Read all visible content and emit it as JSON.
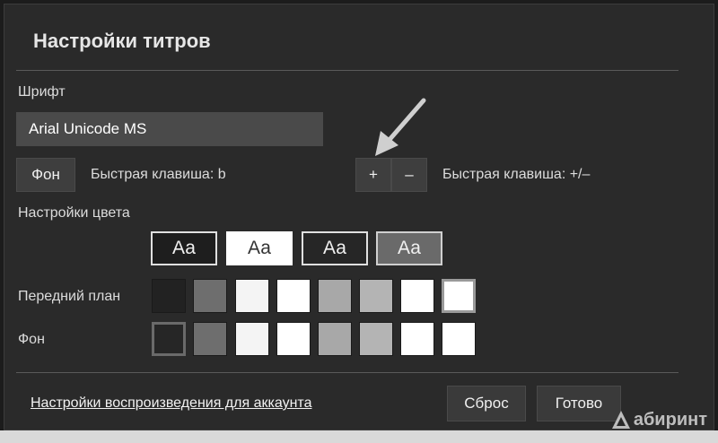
{
  "dialog": {
    "title": "Настройки титров",
    "font_section_label": "Шрифт",
    "font_value": "Arial Unicode MS",
    "background_button": "Фон",
    "background_hotkey": "Быстрая клавиша: b",
    "size_plus": "+",
    "size_minus": "–",
    "size_hotkey": "Быстрая клавиша: +/–",
    "color_section_label": "Настройки цвета",
    "previews": [
      {
        "text": "Аа",
        "bg": "#1e1e1e",
        "fg": "#f0f0f0",
        "border": "#e0e0e0"
      },
      {
        "text": "Аа",
        "bg": "#ffffff",
        "fg": "#333333",
        "border": "#ffffff"
      },
      {
        "text": "Аа",
        "bg": "#262626",
        "fg": "#f0f0f0",
        "border": "#e0e0e0"
      },
      {
        "text": "Аа",
        "bg": "#6a6a6a",
        "fg": "#f0f0f0",
        "border": "#d0d0d0"
      }
    ],
    "foreground_label": "Передний план",
    "foreground_colors": [
      "#222222",
      "#6e6e6e",
      "#f4f4f4",
      "#ffffff",
      "#a8a8a8",
      "#b4b4b4",
      "#ffffff",
      "#ffffff"
    ],
    "background_label": "Фон",
    "background_colors": [
      "#262626",
      "#6e6e6e",
      "#f4f4f4",
      "#ffffff",
      "#a8a8a8",
      "#b4b4b4",
      "#ffffff",
      "#ffffff"
    ],
    "account_link": "Настройки воспроизведения для аккаунта",
    "reset_button": "Сброс",
    "done_button": "Готово"
  },
  "watermark": "абиринт"
}
